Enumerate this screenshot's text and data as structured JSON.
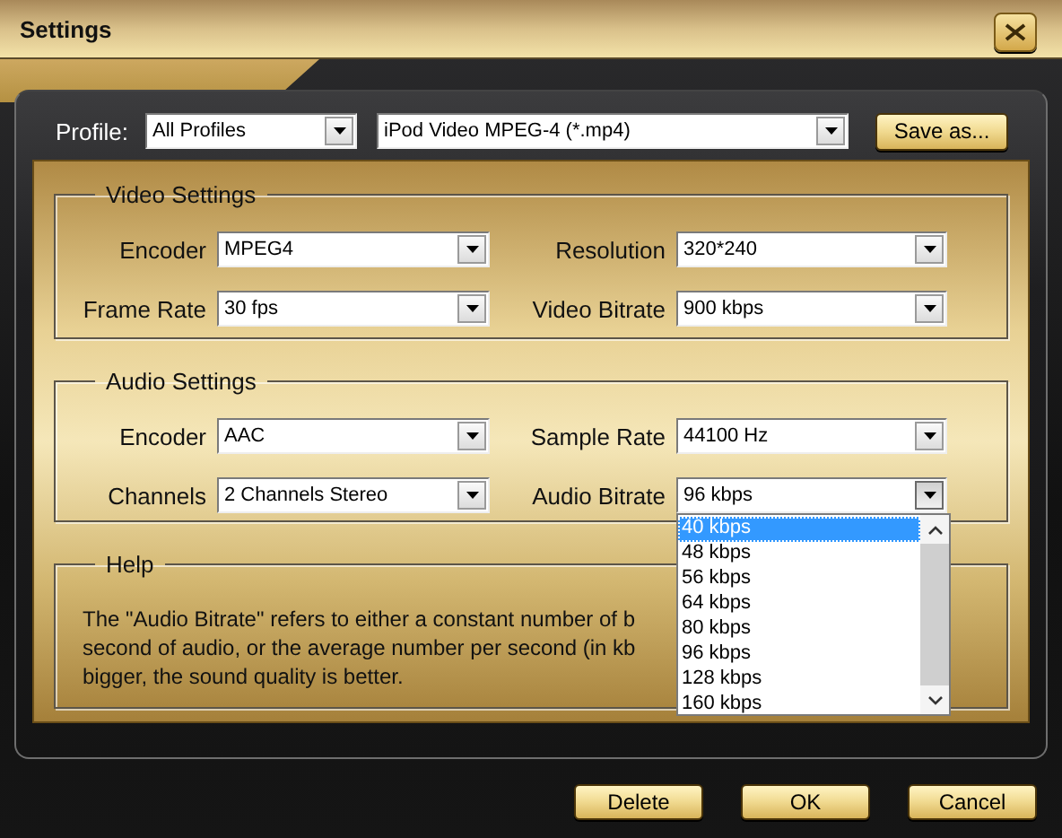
{
  "window": {
    "title": "Settings"
  },
  "profile": {
    "label": "Profile:",
    "category": "All Profiles",
    "preset": "iPod Video MPEG-4 (*.mp4)",
    "save_button": "Save as..."
  },
  "sections": [
    {
      "title": "Video Settings",
      "fields": [
        {
          "label": "Encoder",
          "value": "MPEG4",
          "expanded": false
        },
        {
          "label": "Resolution",
          "value": "320*240",
          "expanded": false
        },
        {
          "label": "Frame Rate",
          "value": "30 fps",
          "expanded": false
        },
        {
          "label": "Video Bitrate",
          "value": "900 kbps",
          "expanded": false
        }
      ]
    },
    {
      "title": "Audio Settings",
      "fields": [
        {
          "label": "Encoder",
          "value": "AAC",
          "expanded": false
        },
        {
          "label": "Sample Rate",
          "value": "44100 Hz",
          "expanded": false
        },
        {
          "label": "Channels",
          "value": "2 Channels Stereo",
          "expanded": false
        },
        {
          "label": "Audio Bitrate",
          "value": "96 kbps",
          "expanded": true,
          "options": [
            {
              "label": "40 kbps",
              "highlighted": true
            },
            {
              "label": "48 kbps",
              "highlighted": false
            },
            {
              "label": "56 kbps",
              "highlighted": false
            },
            {
              "label": "64 kbps",
              "highlighted": false
            },
            {
              "label": "80 kbps",
              "highlighted": false
            },
            {
              "label": "96 kbps",
              "highlighted": false
            },
            {
              "label": "128 kbps",
              "highlighted": false
            },
            {
              "label": "160 kbps",
              "highlighted": false
            }
          ]
        }
      ]
    }
  ],
  "help": {
    "title": "Help",
    "lines": [
      "The \"Audio Bitrate\" refers to either a constant number of b",
      "second of audio, or the average number per second (in kb",
      "bigger, the sound quality is better."
    ]
  },
  "buttons": [
    "Delete",
    "OK",
    "Cancel"
  ]
}
